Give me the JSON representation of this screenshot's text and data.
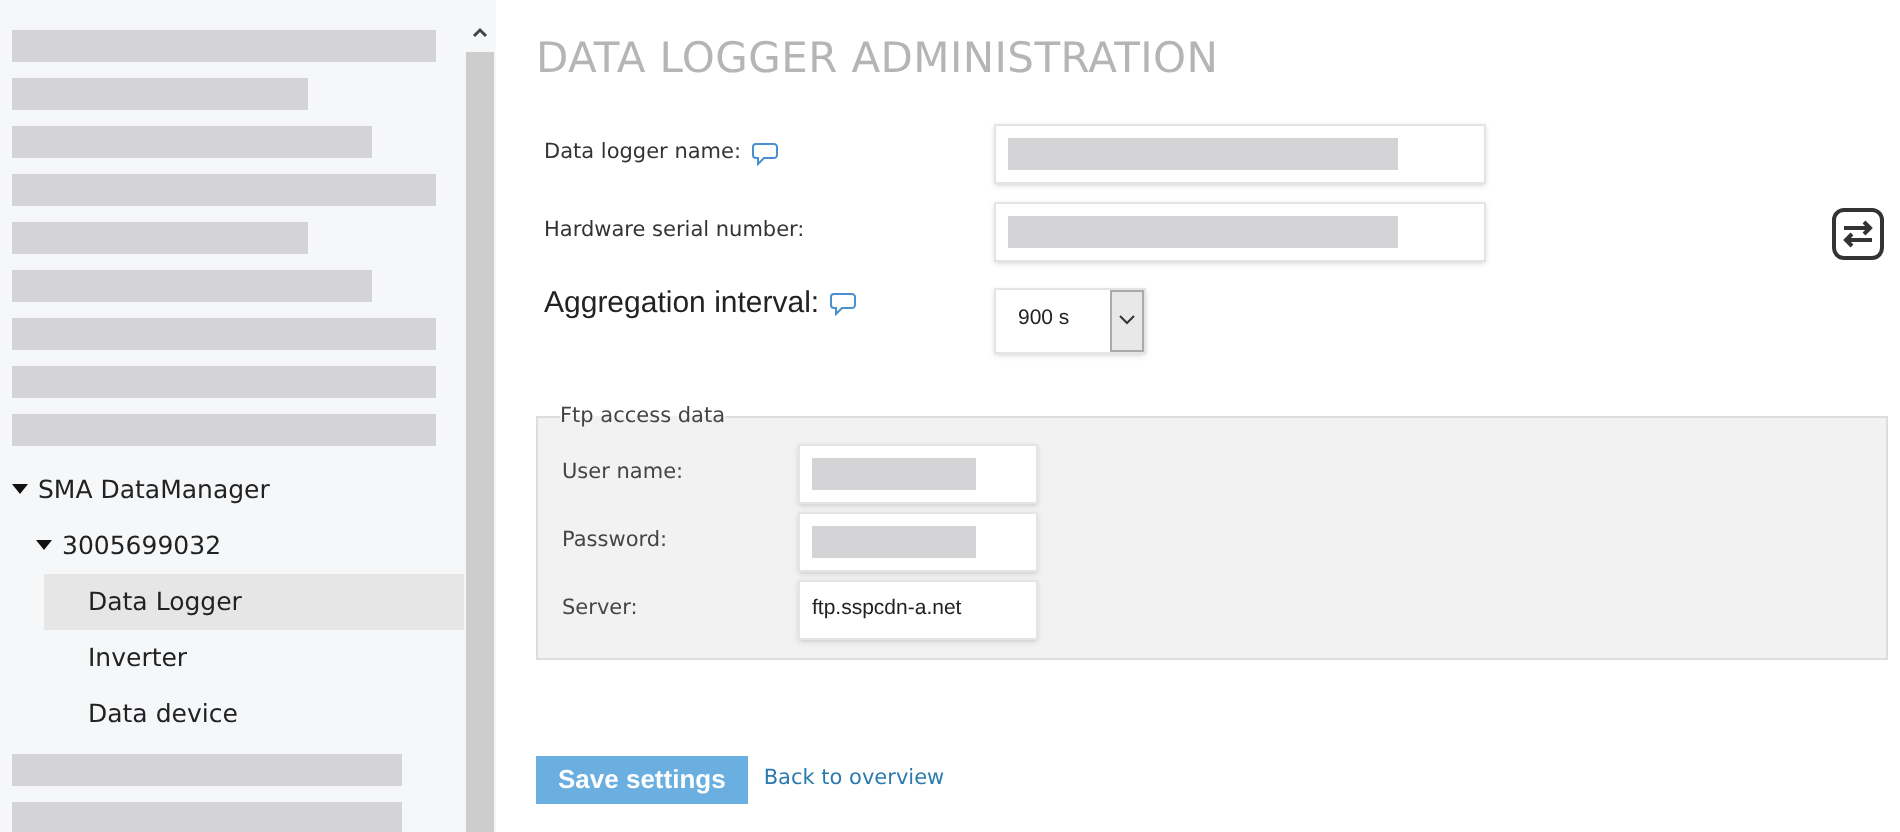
{
  "sidebar": {
    "redacted_top": [
      {
        "kind": "long"
      },
      {
        "kind": "short"
      },
      {
        "kind": "medium"
      },
      {
        "kind": "long"
      },
      {
        "kind": "short"
      },
      {
        "kind": "medium"
      },
      {
        "kind": "long"
      },
      {
        "kind": "long"
      },
      {
        "kind": "long"
      }
    ],
    "tree": [
      {
        "label": "SMA DataManager",
        "expanded": true,
        "selected": false,
        "children": [
          {
            "label": "3005699032",
            "expanded": true,
            "selected": false,
            "children": [
              {
                "label": "Data Logger",
                "selected": true
              },
              {
                "label": "Inverter",
                "selected": false
              },
              {
                "label": "Data device",
                "selected": false
              }
            ]
          }
        ]
      }
    ],
    "redacted_bottom": [
      {
        "kind": "medium"
      },
      {
        "kind": "medium"
      }
    ]
  },
  "title": "DATA LOGGER ADMINISTRATION",
  "fields": [
    {
      "kind": "text",
      "label": "Data logger name:",
      "help": true,
      "redacted": true
    },
    {
      "kind": "text",
      "label": "Hardware serial number:",
      "help": false,
      "redacted": true
    },
    {
      "kind": "select",
      "label": "Aggregation interval:",
      "help": true,
      "value": "900 s"
    }
  ],
  "ftp": {
    "legend": "Ftp access data",
    "fields": [
      {
        "label": "User name:",
        "redacted": true
      },
      {
        "label": "Password:",
        "redacted": true
      },
      {
        "label": "Server:",
        "redacted": false,
        "value": "ftp.sspcdn-a.net"
      }
    ]
  },
  "save_button": "Save settings",
  "back_link": "Back to overview"
}
